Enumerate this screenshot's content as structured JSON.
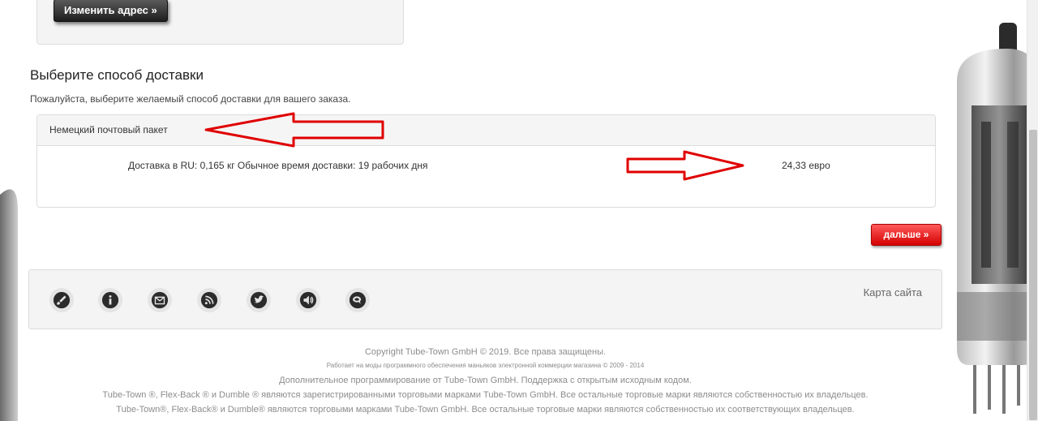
{
  "address": {
    "change_button": "Изменить адрес »"
  },
  "shipping": {
    "title": "Выберите способ доставки",
    "description": "Пожалуйста, выберите желаемый способ доставки для вашего заказа.",
    "method_name": "Немецкий почтовый пакет",
    "method_detail": "Доставка в RU: 0,165 кг Обычное время доставки: 19 рабочих дня",
    "price": "24,33 евро"
  },
  "next_button": "дальше »",
  "footer": {
    "icons": [
      "guitar-icon",
      "info-icon",
      "mail-icon",
      "rss-icon",
      "twitter-icon",
      "speaker-icon",
      "chat-icon"
    ],
    "sitemap": "Карта сайта",
    "copyright": "Copyright Tube-Town GmbH © 2019. Все права защищены.",
    "powered": "Работает на моды программного обеспечения маньяков электронной коммерции магазина © 2009 - 2014",
    "extra_dev": "Дополнительное программирование от Tube-Town GmbH. Поддержка с открытым исходным кодом.",
    "trademarks_1": "Tube-Town ®, Flex-Back ® и Dumble ® являются зарегистрированными торговыми марками Tube-Town GmbH. Все остальные торговые марки являются собственностью их владельцев.",
    "trademarks_2": "Tube-Town®, Flex-Back® и Dumble® являются торговыми марками Tube-Town GmbH. Все остальные торговые марки являются собственностью их соответствующих владельцев."
  },
  "colors": {
    "next_button": "#e60000",
    "annotation_arrow": "#e00000"
  }
}
